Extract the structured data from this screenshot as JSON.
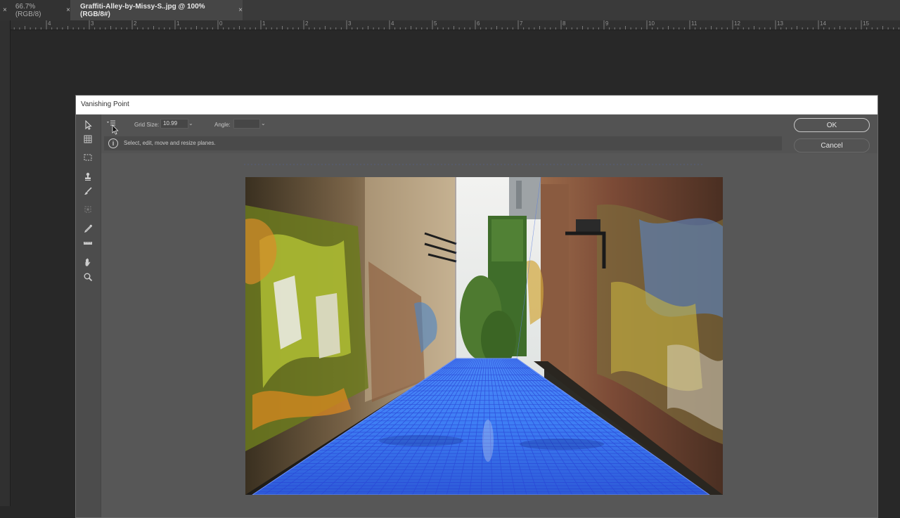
{
  "document_tabs": [
    {
      "label": "66.7% (RGB/8)",
      "close": "×"
    },
    {
      "label": "Graffiti-Alley-by-Missy-S..jpg @ 100% (RGB/8#)",
      "close": "×"
    }
  ],
  "ruler": {
    "numbers": [
      "4",
      "3",
      "2",
      "1",
      "0",
      "1",
      "2",
      "3",
      "4",
      "5",
      "6",
      "7",
      "8",
      "9",
      "10",
      "11",
      "12",
      "13",
      "14",
      "15"
    ]
  },
  "dialog": {
    "title": "Vanishing Point",
    "options": {
      "grid_size_label": "Grid Size:",
      "grid_size_value": "10.99",
      "angle_label": "Angle:",
      "angle_value": ""
    },
    "info_text": "Select, edit, move and resize planes.",
    "ok_label": "OK",
    "cancel_label": "Cancel"
  },
  "colors": {
    "plane_fill": "#3f7ff5",
    "grid_lines": "#2a46d6",
    "dialog_bg": "#535353"
  }
}
